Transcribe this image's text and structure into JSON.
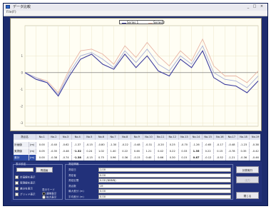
{
  "window": {
    "title": "データ比較",
    "menu": [
      "File(F)"
    ],
    "controls": [
      "_",
      "□",
      "×"
    ]
  },
  "chart": {
    "legend": [
      "Series 1",
      "Series 2"
    ],
    "y_tick_labels": [
      "1",
      "0",
      "-1",
      "-2",
      "-3"
    ],
    "y_marker_label": "0m0"
  },
  "chart_data": {
    "type": "line",
    "x": [
      1,
      2,
      3,
      4,
      5,
      6,
      7,
      8,
      9,
      10,
      11,
      12,
      13,
      14,
      15,
      16,
      17,
      18,
      19,
      20,
      21,
      22
    ],
    "series": [
      {
        "values": [
          0.0,
          -0.4,
          -0.6,
          -1.4,
          -0.2,
          0.8,
          1.1,
          0.5,
          0.2,
          1.1,
          0.3,
          1.0,
          0.1,
          -0.2,
          0.8,
          0.3,
          1.3,
          -0.3,
          -0.7,
          -0.8,
          -1.2,
          -0.5
        ]
      },
      {
        "values": [
          0.0,
          -0.3,
          -0.5,
          -1.2,
          0.2,
          1.3,
          1.4,
          1.1,
          0.5,
          1.6,
          0.9,
          1.8,
          1.0,
          0.4,
          1.3,
          0.7,
          2.0,
          0.4,
          -0.2,
          -0.2,
          -0.6,
          0.1
        ]
      },
      {
        "values": [
          0.0,
          -0.3,
          -0.6,
          -1.3,
          0.0,
          1.0,
          1.2,
          0.8,
          0.3,
          1.3,
          0.6,
          1.4,
          0.5,
          0.1,
          1.0,
          0.5,
          1.6,
          0.0,
          -0.4,
          -0.5,
          -0.9,
          -0.2
        ]
      }
    ],
    "ylim": [
      -3.2,
      2.8
    ],
    "grid": true,
    "colors": [
      "#3a3a9e",
      "#e8b4a4",
      "#a9b0d8"
    ]
  },
  "table": {
    "corner": "測点名",
    "columns": [
      "No.1",
      "No.2",
      "No.3",
      "No.4",
      "No.5",
      "No.6",
      "No.7",
      "No.8",
      "No.9",
      "No.10",
      "No.11",
      "No.12",
      "No.13",
      "No.14",
      "No.15",
      "No.16",
      "No.17",
      "No.18",
      "No.19"
    ],
    "rows": [
      {
        "label": "計画値",
        "unit": "(m)",
        "cells": [
          "0.00",
          "-0.40",
          "-0.62",
          "-1.37",
          "-0.15",
          "-0.80",
          "-1.30",
          "-0.22",
          "-0.48",
          "-0.31",
          "-0.20",
          "0.25",
          "-0.70",
          "-1.26",
          "-0.65",
          "-0.17",
          "-0.48",
          "-1.23",
          "-0.38"
        ]
      },
      {
        "label": "実測値",
        "unit": "(m)",
        "cells": [
          "0.05",
          "-0.35",
          "-0.48",
          "-1.32",
          "0.24",
          "1.02",
          "1.40",
          "0.22",
          "0.46",
          "1.21",
          "0.42",
          "0.22",
          "0.33",
          "1.35",
          "0.22",
          "0.15",
          "-0.78",
          "0.35",
          "-0.42"
        ],
        "bold": [
          3,
          13
        ]
      },
      {
        "label": "差分",
        "unit": "(m)",
        "cells": [
          "0.00",
          "-0.38",
          "-0.74",
          "-1.38",
          "-0.15",
          "0.75",
          "0.96",
          "0.36",
          "-0.15",
          "0.40",
          "0.66",
          "0.30",
          "0.15",
          "0.87",
          "-0.12",
          "-0.52",
          "-1.21",
          "-0.36",
          "-0.46"
        ],
        "bold": [
          3,
          13
        ],
        "selected": true
      }
    ]
  },
  "left_panel": {
    "group_title": "表示設定",
    "input_value": "",
    "button": "再描画",
    "checks": [
      "計画線を表示",
      "実測線を表示",
      "差分を表示",
      "グリッド表示"
    ],
    "radio_title": "表示モード",
    "radios": [
      {
        "label": "通常表示",
        "selected": true
      },
      {
        "label": "拡大表示",
        "selected": false
      }
    ]
  },
  "info": {
    "group_title": "測定情報",
    "rows": [
      {
        "label": "測定日",
        "value": "1.00"
      },
      {
        "label": "測定者",
        "value": "0.00"
      },
      {
        "label": "測定区間",
        "value": "0.00 (NNNN)"
      },
      {
        "label": "測点数",
        "value": "19"
      },
      {
        "label": "最大差分 (m)",
        "value": "0.00"
      },
      {
        "label": "平均差分 (m)",
        "value": "0.00"
      }
    ]
  },
  "right_buttons": {
    "top": "計算実行",
    "middle": "出力",
    "bottom": "閉じる"
  }
}
